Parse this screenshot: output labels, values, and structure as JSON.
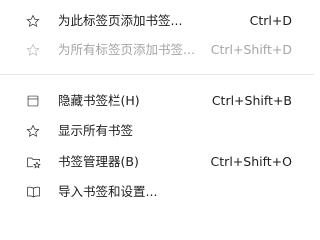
{
  "menu": {
    "items": [
      {
        "label": "为此标签页添加书签...",
        "shortcut": "Ctrl+D",
        "icon": "star-icon",
        "enabled": true
      },
      {
        "label": "为所有标签页添加书签...",
        "shortcut": "Ctrl+Shift+D",
        "icon": "star-icon",
        "enabled": false
      },
      {
        "label": "隐藏书签栏(H)",
        "shortcut": "Ctrl+Shift+B",
        "icon": "bookmarks-bar-icon",
        "enabled": true
      },
      {
        "label": "显示所有书签",
        "shortcut": "",
        "icon": "star-icon",
        "enabled": true
      },
      {
        "label": "书签管理器(B)",
        "shortcut": "Ctrl+Shift+O",
        "icon": "folder-star-icon",
        "enabled": true
      },
      {
        "label": "导入书签和设置...",
        "shortcut": "",
        "icon": "book-import-icon",
        "enabled": true
      }
    ]
  }
}
